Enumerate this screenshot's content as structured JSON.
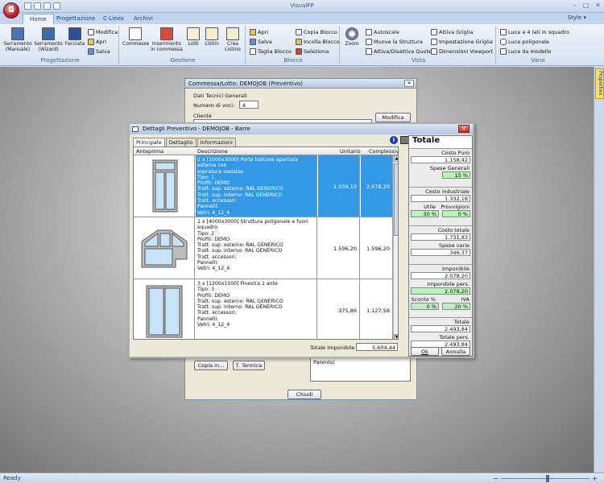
{
  "app": {
    "title": "VisualFP"
  },
  "ribbon_tabs": [
    "Home",
    "Progettazione",
    "C-Lines",
    "Archivi"
  ],
  "style_label": "Style",
  "ribbon": {
    "progettazione": {
      "title": "Progettazione",
      "serr_manuale": "Serramento\n(Manuale)",
      "serr_wizard": "Serramento\n(Wizard)",
      "facciata": "Facciata",
      "modifica": "Modifica",
      "apri": "Apri",
      "salva": "Salva"
    },
    "gestione": {
      "title": "Gestione",
      "commesse": "Commesse",
      "inserimento": "Inserimento\nin commessa",
      "lotti": "Lotti",
      "listini": "Listini",
      "crea_listino": "Crea\nListino"
    },
    "blocco": {
      "title": "Blocco",
      "apri": "Apri",
      "salva": "Salva",
      "taglia": "Taglia Blocco",
      "copia": "Copia Blocco",
      "incolla": "Incolla Blocco",
      "seleziona": "Seleziona"
    },
    "vista": {
      "title": "Vista",
      "zoom": "Zoom",
      "autoscale": "Autoscale",
      "muove": "Muove la Struttura",
      "attiva_quote": "Attiva/Disattiva Quote",
      "attiva_griglia": "Attiva Griglia",
      "impostazione": "Impostazione Griglia",
      "dimensioni": "Dimensioni Viewport"
    },
    "vano": {
      "title": "Vano",
      "luce4": "Luce a 4 lati in squadro",
      "poligonale": "Luce poligonale",
      "modello": "Luce da modello"
    }
  },
  "side_panel": "Properties",
  "status": "Ready",
  "bg_dialog": {
    "title": "Commessa/Lotto: DEMOJOB (Preventivo)",
    "section": "Dati Tecnici Generali",
    "numero_label": "Numero di voci:",
    "numero_value": "4",
    "cliente_label": "Cliente",
    "cliente_value": "",
    "modifica_btn": "Modifica",
    "copia_btn": "Copia in...",
    "termica_btn": "T. Termica",
    "chiudi_btn": "Chiudi",
    "note_text": "Parents)"
  },
  "preventivo": {
    "title": "Dettagli Preventivo - DEMOJOB - Barre",
    "tabs": [
      "Principale",
      "Dettaglio",
      "Informazioni"
    ],
    "columns": [
      "Anteprima",
      "Descrizione",
      "Unitario",
      "Complessivo"
    ],
    "rows": [
      {
        "lines": [
          "2 x [1000x3000] Porta balcone apertura esterna con",
          "sopraluce vasistas",
          "Tipo: 1",
          "Profili: DEMO",
          "Tratt. sup. esterno: RAL GENERICO",
          "Tratt. sup. interno: RAL GENERICO",
          "Tratt. accessori:",
          "Pannelli:",
          "Vetri: 4_12_4"
        ],
        "unitario": "1.039,10",
        "complessivo": "2.078,20"
      },
      {
        "lines": [
          "1 x [4000x3000] Struttura poligonale e fuori squadro",
          "Tipo: 2",
          "Profili: DEMO",
          "Tratt. sup. esterno: RAL GENERICO",
          "Tratt. sup. interno: RAL GENERICO",
          "Tratt. accessori:",
          "Pannelli:",
          "Vetri: 4_12_4"
        ],
        "unitario": "1.596,20",
        "complessivo": "1.596,20"
      },
      {
        "lines": [
          "3 x [1200x1500] Finestra 2 ante",
          "Tipo: 3",
          "Profili: DEMO",
          "Tratt. sup. esterno: RAL GENERICO",
          "Tratt. sup. interno: RAL GENERICO",
          "Tratt. accessori:",
          "Pannelli:",
          "Vetri: 4_12_4"
        ],
        "unitario": "375,86",
        "complessivo": "1.127,58"
      }
    ],
    "totale_imponibile_label": "Totale Imponibile",
    "totale_imponibile_value": "5.604,44",
    "totale": {
      "title": "Totale",
      "costo_puro_l": "Costo Puro",
      "costo_puro_v": "1.158,42",
      "spese_generali_l": "Spese Generali",
      "spese_generali_v": "15 %",
      "costo_industriale_l": "Costo industriale",
      "costo_industriale_v": "1.332,18",
      "utile_l": "Utile",
      "utile_v": "30 %",
      "provvigioni_l": "Provvigioni",
      "provvigioni_v": "0 %",
      "costo_totale_l": "Costo totale",
      "costo_totale_v": "1.731,83",
      "spese_varie_l": "Spese varie",
      "spese_varie_v": "346,37",
      "imponibile_l": "Imponibile",
      "imponibile_v": "2.078,20",
      "imponibile_pers_l": "Imponibile pers.",
      "imponibile_pers_v": "2.078,20",
      "sconto_l": "Sconto %",
      "sconto_v": "0 %",
      "iva_l": "IVA",
      "iva_v": "20 %",
      "totale_l": "Totale",
      "totale_v": "2.493,84",
      "totale_pers_l": "Totale pers.",
      "totale_pers_v": "2.493,84",
      "ok_btn": "Ok",
      "annulla_btn": "Annulla"
    }
  },
  "colors": {
    "selection": "#3399e6",
    "green_field": "#b9f3b9",
    "ribbon": "#d5e2f2"
  }
}
